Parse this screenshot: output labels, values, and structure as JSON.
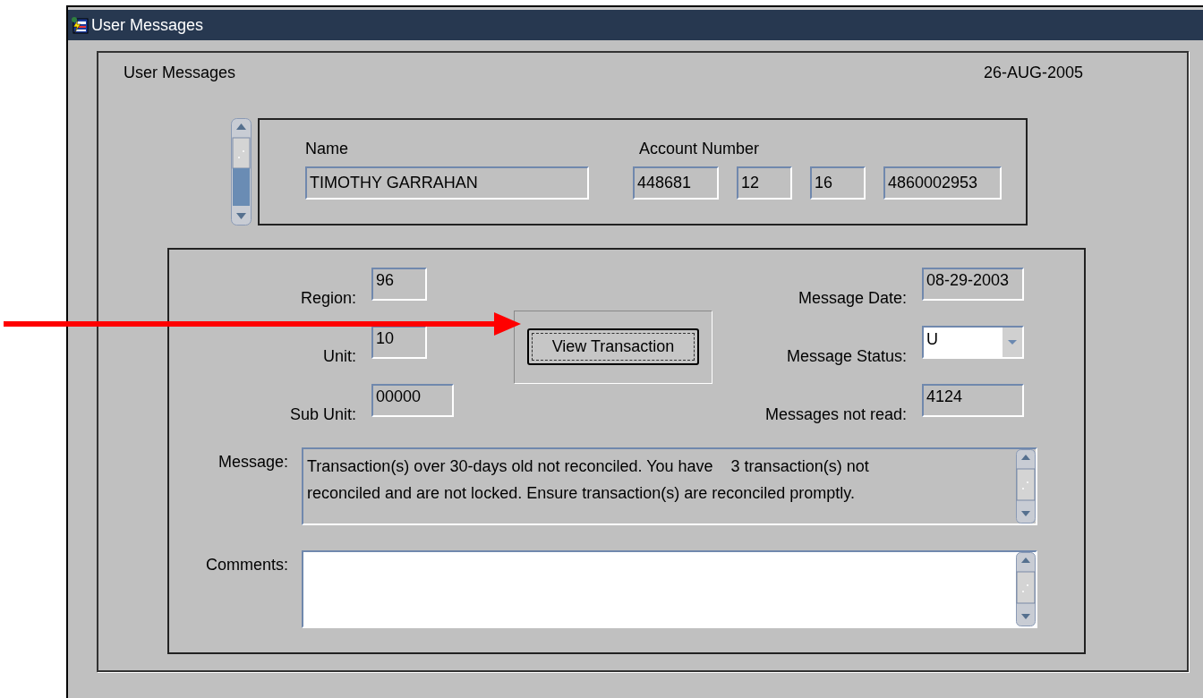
{
  "window": {
    "title": "User Messages"
  },
  "form": {
    "heading": "User Messages",
    "date": "26-AUG-2005"
  },
  "header": {
    "name_label": "Name",
    "name": "TIMOTHY GARRAHAN",
    "account_label": "Account Number",
    "account_parts": [
      "448681",
      "12",
      "16",
      "4860002953"
    ]
  },
  "details": {
    "left_fields": [
      {
        "label": "Region:",
        "value": "96"
      },
      {
        "label": "Unit:",
        "value": "10"
      },
      {
        "label": "Sub Unit:",
        "value": "00000"
      }
    ],
    "button": "View Transaction",
    "right_fields": [
      {
        "label": "Message Date:",
        "value": "08-29-2003",
        "kind": "text"
      },
      {
        "label": "Message Status:",
        "value": "U",
        "kind": "dropdown"
      },
      {
        "label": "Messages not read:",
        "value": "4124",
        "kind": "text"
      }
    ],
    "message_label": "Message:",
    "message": "Transaction(s) over 30-days old not reconciled. You have    3 transaction(s) not reconciled and are not locked. Ensure transaction(s) are reconciled promptly.",
    "comments_label": "Comments:"
  }
}
